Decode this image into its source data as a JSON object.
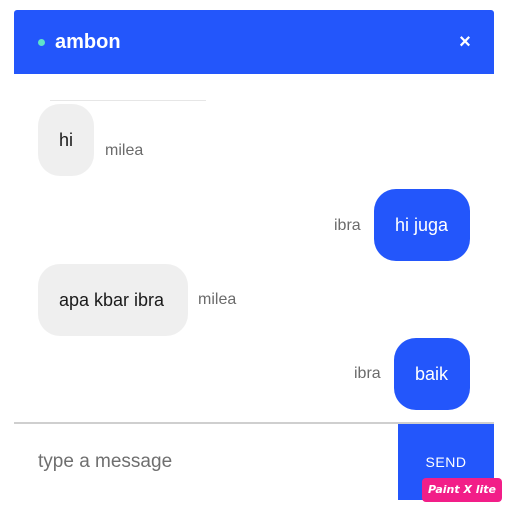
{
  "colors": {
    "accent": "#2356fb",
    "status_online": "#5fe3c9",
    "received_bubble": "#efefef"
  },
  "header": {
    "room_name": "ambon",
    "close_icon": "close-icon",
    "close_glyph": "×"
  },
  "messages": [
    {
      "text": "hi",
      "sender": "milea",
      "direction": "received"
    },
    {
      "text": "hi juga",
      "sender": "ibra",
      "direction": "sent"
    },
    {
      "text": "apa kbar ibra",
      "sender": "milea",
      "direction": "received"
    },
    {
      "text": "baik",
      "sender": "ibra",
      "direction": "sent"
    }
  ],
  "composer": {
    "placeholder": "type a message",
    "value": "",
    "send_label": "SEND"
  },
  "watermark": "Paint X lite"
}
